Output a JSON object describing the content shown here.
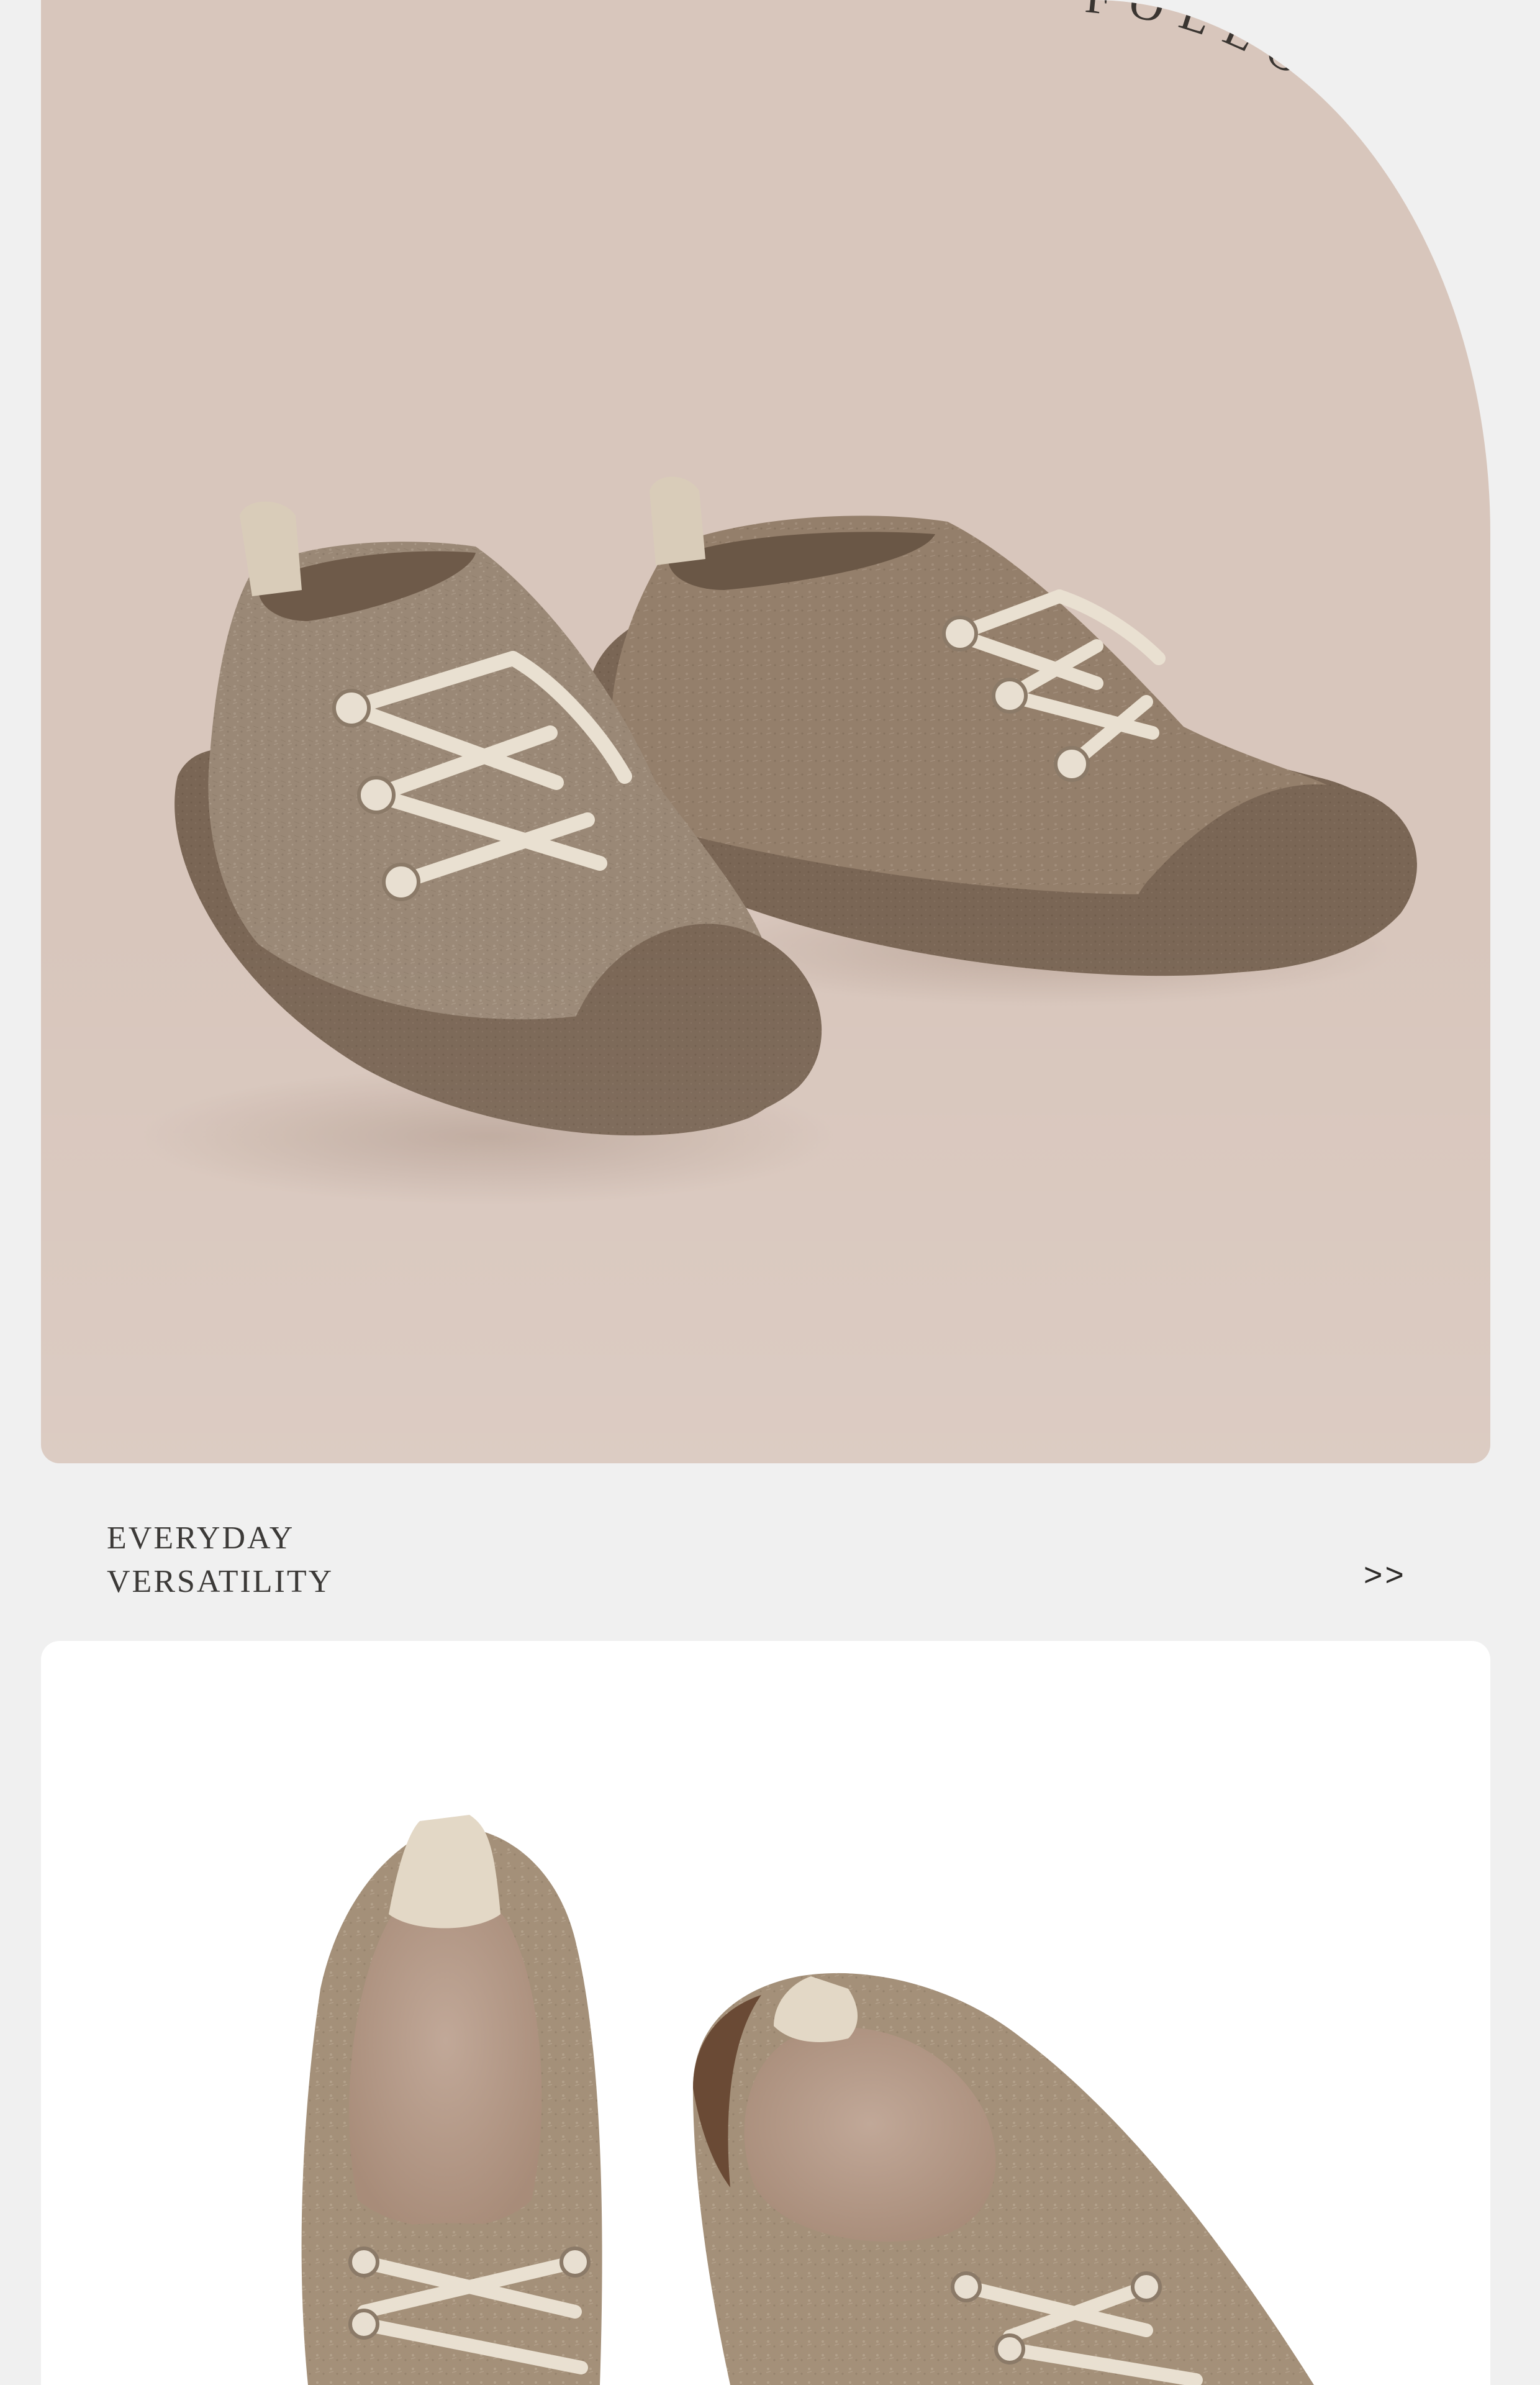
{
  "hero": {
    "brand_arc_text": "FOLLOWME WARM",
    "image_alt": "Pair of taupe felt lace-up chukka shoes with brown rubber toe caps on a blush background",
    "colors": {
      "background": "#d8c6bc",
      "felt": "#9c8a78",
      "sole": "#7a6655",
      "lace": "#e6dccd"
    }
  },
  "section": {
    "title_line1": "EVERYDAY",
    "title_line2": "VERSATILITY",
    "more_link": ">>"
  },
  "detail": {
    "image_alt": "Top-down view of the felt shoes showing the padded insoles and heel pull tabs",
    "colors": {
      "background": "#ffffff",
      "insole": "#b89e8c"
    }
  }
}
